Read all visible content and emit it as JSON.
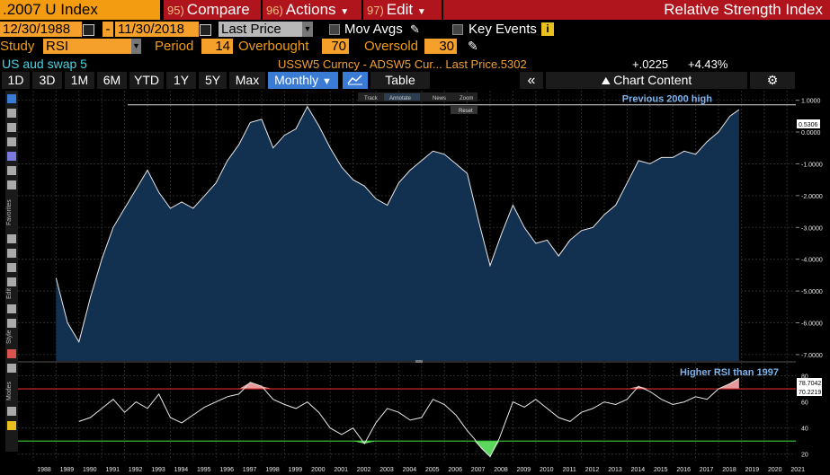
{
  "topbar": {
    "ticker": ".2007 U Index",
    "compare_num": "95)",
    "compare": "Compare",
    "actions_num": "96)",
    "actions": "Actions",
    "edit_num": "97)",
    "edit": "Edit",
    "title": "Relative Strength Index"
  },
  "controls": {
    "start_date": "12/30/1988",
    "dash": "-",
    "end_date": "11/30/2018",
    "price_field": "Last Price",
    "mov_avgs": "Mov Avgs",
    "key_events": "Key Events",
    "study_label": "Study",
    "study_value": "RSI",
    "period_label": "Period",
    "period_value": "14",
    "overbought_label": "Overbought",
    "overbought_value": "70",
    "oversold_label": "Oversold",
    "oversold_value": "30"
  },
  "info": {
    "security": "US aud swap 5",
    "desc": "USSW5 Curncy - ADSW5 Cur... Last Price",
    "last_price": ".5302",
    "change": "+.0225",
    "change_pct": "+4.43%"
  },
  "tabs": {
    "t1d": "1D",
    "t3d": "3D",
    "t1m": "1M",
    "t6m": "6M",
    "tytd": "YTD",
    "t1y": "1Y",
    "t5y": "5Y",
    "tmax": "Max",
    "freq": "Monthly",
    "table": "Table",
    "chart_content": "Chart Content"
  },
  "chart_toolbar": {
    "track": "Track",
    "annotate": "Annotate",
    "news": "News",
    "zoom": "Zoom",
    "reset": "Reset"
  },
  "sidebar": {
    "favorites": "Favorites",
    "edit": "Edit",
    "style": "Style",
    "modes": "Modes"
  },
  "colors": {
    "accent_orange": "#f39c12",
    "title_red": "#b0141c",
    "selected_blue": "#3a7bd5",
    "overbought_line": "#d92b2b",
    "oversold_line": "#3ccc3c"
  },
  "chart_data": [
    {
      "type": "area",
      "title": "",
      "annotation": "Previous 2000 high",
      "last_value_label": "0.5306",
      "ylim": [
        -7.2,
        1.3
      ],
      "yticks": [
        "1.0000",
        "0.0000",
        "-1.0000",
        "-2.0000",
        "-3.0000",
        "-4.0000",
        "-5.0000",
        "-6.0000",
        "-7.0000"
      ],
      "ytick_values": [
        1,
        0,
        -1,
        -2,
        -3,
        -4,
        -5,
        -6,
        -7
      ],
      "x": [
        1989.0,
        1989.5,
        1990.0,
        1990.5,
        1991.0,
        1991.5,
        1992.0,
        1992.5,
        1993.0,
        1993.5,
        1994.0,
        1994.5,
        1995.0,
        1995.5,
        1996.0,
        1996.5,
        1997.0,
        1997.5,
        1998.0,
        1998.5,
        1999.0,
        1999.5,
        2000.0,
        2000.5,
        2001.0,
        2001.5,
        2002.0,
        2002.5,
        2003.0,
        2003.5,
        2004.0,
        2004.5,
        2005.0,
        2005.5,
        2006.0,
        2006.5,
        2007.0,
        2007.5,
        2008.0,
        2008.5,
        2009.0,
        2009.5,
        2010.0,
        2010.5,
        2011.0,
        2011.5,
        2012.0,
        2012.5,
        2013.0,
        2013.5,
        2014.0,
        2014.5,
        2015.0,
        2015.5,
        2016.0,
        2016.5,
        2017.0,
        2017.5,
        2018.0,
        2018.5,
        2018.9
      ],
      "values": [
        -4.6,
        -6.0,
        -6.6,
        -5.2,
        -4.0,
        -3.0,
        -2.4,
        -1.8,
        -1.2,
        -1.9,
        -2.4,
        -2.2,
        -2.4,
        -2.0,
        -1.6,
        -0.9,
        -0.4,
        0.3,
        0.4,
        -0.5,
        -0.1,
        0.1,
        0.8,
        0.2,
        -0.5,
        -1.1,
        -1.5,
        -1.7,
        -2.1,
        -2.3,
        -1.6,
        -1.2,
        -0.9,
        -0.6,
        -0.7,
        -1.0,
        -1.3,
        -2.8,
        -4.2,
        -3.2,
        -2.3,
        -3.0,
        -3.5,
        -3.4,
        -3.9,
        -3.4,
        -3.1,
        -3.0,
        -2.6,
        -2.3,
        -1.6,
        -0.9,
        -1.0,
        -0.8,
        -0.8,
        -0.6,
        -0.7,
        -0.3,
        0.0,
        0.5,
        0.7
      ]
    },
    {
      "type": "line",
      "title": "",
      "annotation": "Higher RSI than 1997",
      "current_value_label": "78.7042",
      "overbought_value_label": "70.2219",
      "ylim": [
        15,
        90
      ],
      "yticks": [
        "80",
        "60",
        "40",
        "20"
      ],
      "ytick_values": [
        80,
        60,
        40,
        20
      ],
      "overbought": 70,
      "oversold": 30,
      "x": [
        1990.0,
        1990.5,
        1991.0,
        1991.5,
        1992.0,
        1992.5,
        1993.0,
        1993.5,
        1994.0,
        1994.5,
        1995.0,
        1995.5,
        1996.0,
        1996.5,
        1997.0,
        1997.5,
        1998.0,
        1998.5,
        1999.0,
        1999.5,
        2000.0,
        2000.5,
        2001.0,
        2001.5,
        2002.0,
        2002.5,
        2003.0,
        2003.5,
        2004.0,
        2004.5,
        2005.0,
        2005.5,
        2006.0,
        2006.5,
        2007.0,
        2007.3,
        2007.6,
        2008.0,
        2008.4,
        2009.0,
        2009.5,
        2010.0,
        2010.5,
        2011.0,
        2011.5,
        2012.0,
        2012.5,
        2013.0,
        2013.5,
        2014.0,
        2014.5,
        2015.0,
        2015.5,
        2016.0,
        2016.5,
        2017.0,
        2017.5,
        2018.0,
        2018.5,
        2018.9
      ],
      "values": [
        45,
        48,
        55,
        62,
        52,
        60,
        55,
        66,
        48,
        44,
        50,
        56,
        60,
        64,
        66,
        75,
        72,
        62,
        58,
        55,
        60,
        52,
        40,
        35,
        40,
        28,
        44,
        55,
        52,
        46,
        48,
        62,
        58,
        50,
        38,
        32,
        25,
        18,
        32,
        60,
        56,
        62,
        55,
        48,
        45,
        52,
        55,
        60,
        58,
        62,
        72,
        68,
        62,
        58,
        60,
        64,
        62,
        70,
        74,
        78
      ]
    }
  ],
  "x_axis_years": [
    "1988",
    "1989",
    "1990",
    "1991",
    "1992",
    "1993",
    "1994",
    "1995",
    "1996",
    "1997",
    "1998",
    "1999",
    "2000",
    "2001",
    "2002",
    "2003",
    "2004",
    "2005",
    "2006",
    "2007",
    "2008",
    "2009",
    "2010",
    "2011",
    "2012",
    "2013",
    "2014",
    "2015",
    "2016",
    "2017",
    "2018",
    "2019",
    "2020",
    "2021"
  ]
}
